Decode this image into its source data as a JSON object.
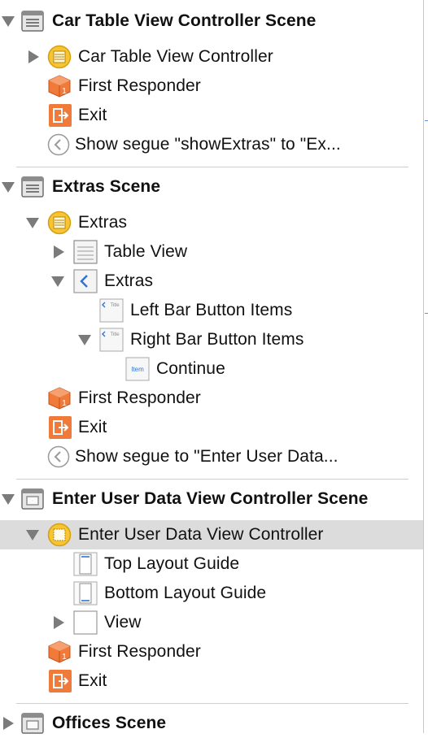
{
  "scenes": [
    {
      "title": "Car Table View Controller Scene",
      "items": {
        "controller": "Car Table View Controller",
        "first_responder": "First Responder",
        "exit": "Exit",
        "segue": "Show segue \"showExtras\" to \"Ex..."
      }
    },
    {
      "title": "Extras Scene",
      "items": {
        "controller": "Extras",
        "table_view": "Table View",
        "nav_item": "Extras",
        "left_bar": "Left Bar Button Items",
        "right_bar": "Right Bar Button Items",
        "continue": "Continue",
        "first_responder": "First Responder",
        "exit": "Exit",
        "segue": "Show segue to \"Enter User Data..."
      }
    },
    {
      "title": "Enter User Data View Controller Scene",
      "items": {
        "controller": "Enter User Data View Controller",
        "top_guide": "Top Layout Guide",
        "bottom_guide": "Bottom Layout Guide",
        "view": "View",
        "first_responder": "First Responder",
        "exit": "Exit"
      }
    },
    {
      "title": "Offices Scene"
    }
  ],
  "icon_text": {
    "title": "Title",
    "item": "Item",
    "responder_number": "1"
  },
  "colors": {
    "accent_orange": "#f07a3a",
    "controller_yellow": "#f7c531",
    "selection_bg": "#dcdcdc",
    "blue": "#2f74d0"
  }
}
